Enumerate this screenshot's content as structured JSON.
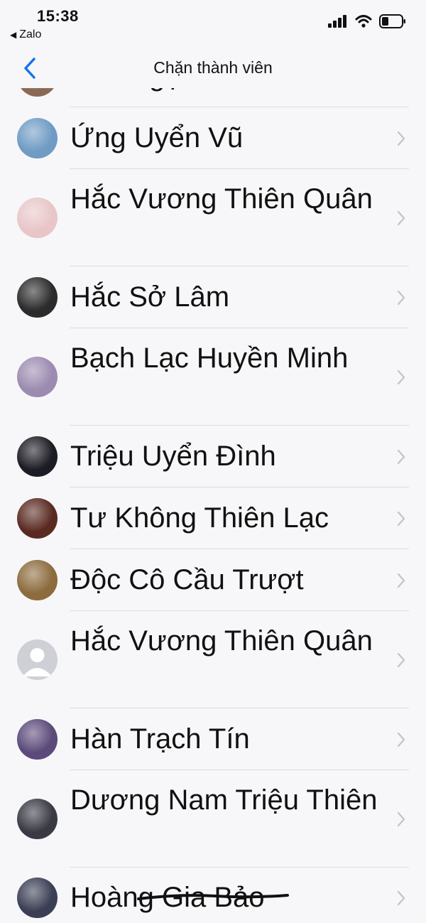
{
  "status_bar": {
    "time": "15:38",
    "back_app": "Zalo",
    "back_arrow": "◀",
    "icons": [
      "signal-icon",
      "wifi-icon",
      "battery-icon"
    ]
  },
  "nav": {
    "back_icon": "chevron-left-icon",
    "title": "Chặn thành viên",
    "accent_color": "#1a73e8"
  },
  "members": [
    {
      "name": "Phó Ngọc Linh",
      "avatar_color": "#8a6a55",
      "partial": true
    },
    {
      "name": "Ứng Uyển Vũ",
      "avatar_color": "#6f9bc4"
    },
    {
      "name": "Hắc Vương Thiên Quân",
      "avatar_color": "#e8c6c8"
    },
    {
      "name": "Hắc Sở Lâm",
      "avatar_color": "#2b2b2b"
    },
    {
      "name": "Bạch Lạc Huyền Minh",
      "avatar_color": "#9b8bb0"
    },
    {
      "name": "Triệu Uyển Đình",
      "avatar_color": "#1c1c24"
    },
    {
      "name": "Tư Không Thiên Lạc",
      "avatar_color": "#5a2a22"
    },
    {
      "name": "Độc Cô Cầu Trượt",
      "avatar_color": "#8c6b3d"
    },
    {
      "name": "Hắc Vương Thiên Quân",
      "avatar_color": "#cfd0d6",
      "default_avatar": true
    },
    {
      "name": "Hàn Trạch Tín",
      "avatar_color": "#5b4a7a"
    },
    {
      "name": "Dương Nam Triệu Thiên",
      "avatar_color": "#3a3a44"
    },
    {
      "name": "Hoàng Gia Bảo",
      "avatar_color": "#3b3f55",
      "struck_through": true
    }
  ],
  "row_chevron_icon": "chevron-right-icon"
}
